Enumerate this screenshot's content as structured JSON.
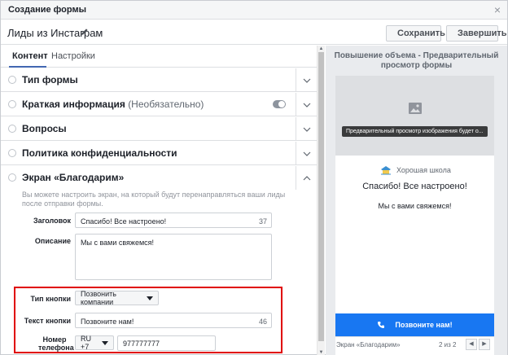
{
  "dialog": {
    "title": "Создание формы",
    "close_glyph": "×"
  },
  "header": {
    "form_name": "Лиды из Инстаграм",
    "save_label": "Сохранить",
    "finish_label": "Завершить"
  },
  "tabs": [
    {
      "label": "Контент",
      "active": true
    },
    {
      "label": "Настройки",
      "active": false
    }
  ],
  "sections": [
    {
      "label": "Тип формы"
    },
    {
      "label": "Краткая информация",
      "optional": "(Необязательно)"
    },
    {
      "label": "Вопросы"
    },
    {
      "label": "Политика конфиденциальности"
    },
    {
      "label": "Экран «Благодарим»"
    }
  ],
  "thank_you": {
    "description": "Вы можете настроить экран, на который будут перенаправляться ваши лиды после отправки формы.",
    "headline_label": "Заголовок",
    "headline_value": "Спасибо! Все настроено!",
    "headline_count": "37",
    "description_label": "Описание",
    "description_value": "Мы с вами свяжемся!",
    "button_type_label": "Тип кнопки",
    "button_type_value": "Позвонить компании",
    "button_text_label": "Текст кнопки",
    "button_text_value": "Позвоните нам!",
    "button_text_count": "46",
    "phone_label": "Номер телефона",
    "phone_country": "RU +7",
    "phone_value": "977777777"
  },
  "preview": {
    "title": "Повышение объема - Предварительный просмотр формы",
    "image_tooltip": "Предварительный просмотр изображения будет о...",
    "brand": "Хорошая школа",
    "headline": "Спасибо! Все настроено!",
    "description": "Мы с вами свяжемся!",
    "cta_label": "Позвоните нам!",
    "footer_screen": "Экран «Благодарим»",
    "footer_pager": "2 из 2",
    "prev_glyph": "◀",
    "next_glyph": "▶"
  },
  "colors": {
    "accent": "#4267b2",
    "cta": "#1877f2",
    "highlight": "#e00000"
  },
  "icons": [
    "close-icon",
    "pencil-icon",
    "save-icon",
    "finish-icon",
    "chevron-down-icon",
    "chevron-up-icon",
    "image-icon",
    "school-logo-icon",
    "phone-icon"
  ]
}
